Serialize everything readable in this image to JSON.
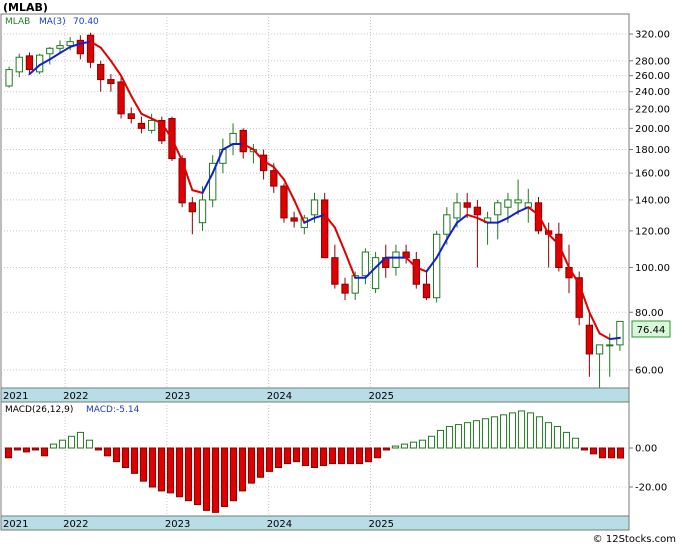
{
  "chart_data": [
    {
      "type": "candlestick",
      "title": "(MLAB)",
      "legend": {
        "symbol": "MLAB",
        "ma_label": "MA(3)",
        "ma_value": "70.40"
      },
      "last_price_label": "76.44",
      "y_scale": "log",
      "ylim": [
        52,
        340
      ],
      "y_ticks": [
        60,
        80,
        100,
        120,
        140,
        160,
        180,
        200,
        220,
        240,
        260,
        280,
        320
      ],
      "y_tick_labels": [
        "60.00",
        "80.00",
        "100.00",
        "120.00",
        "140.00",
        "160.00",
        "180.00",
        "200.00",
        "220.00",
        "240.00",
        "260.00",
        "280.00",
        "320.00"
      ],
      "x_labels": [
        "2021",
        "2022",
        "2023",
        "2024",
        "2025"
      ],
      "series": [
        {
          "name": "MLAB",
          "ohlc": [
            [
              247,
              272,
              245,
              268
            ],
            [
              265,
              290,
              258,
              285
            ],
            [
              287,
              292,
              262,
              268
            ],
            [
              265,
              290,
              262,
              288
            ],
            [
              290,
              300,
              275,
              298
            ],
            [
              298,
              310,
              290,
              302
            ],
            [
              302,
              315,
              295,
              308
            ],
            [
              310,
              318,
              282,
              290
            ],
            [
              318,
              322,
              270,
              278
            ],
            [
              275,
              280,
              240,
              255
            ],
            [
              255,
              262,
              240,
              250
            ],
            [
              252,
              258,
              210,
              215
            ],
            [
              215,
              222,
              205,
              210
            ],
            [
              205,
              212,
              195,
              200
            ],
            [
              198,
              215,
              195,
              208
            ],
            [
              208,
              212,
              185,
              188
            ],
            [
              210,
              212,
              170,
              172
            ],
            [
              172,
              175,
              135,
              138
            ],
            [
              138,
              142,
              118,
              132
            ],
            [
              125,
              150,
              120,
              140
            ],
            [
              140,
              175,
              135,
              168
            ],
            [
              168,
              190,
              160,
              180
            ],
            [
              185,
              205,
              175,
              195
            ],
            [
              198,
              200,
              172,
              178
            ],
            [
              178,
              185,
              168,
              180
            ],
            [
              175,
              180,
              155,
              162
            ],
            [
              162,
              168,
              145,
              150
            ],
            [
              150,
              152,
              125,
              128
            ],
            [
              128,
              132,
              122,
              126
            ],
            [
              122,
              130,
              118,
              128
            ],
            [
              130,
              145,
              125,
              140
            ],
            [
              140,
              145,
              105,
              105
            ],
            [
              105,
              112,
              90,
              92
            ],
            [
              92,
              95,
              85,
              88
            ],
            [
              88,
              98,
              85,
              96
            ],
            [
              96,
              110,
              92,
              108
            ],
            [
              90,
              108,
              88,
              105
            ],
            [
              105,
              112,
              95,
              100
            ],
            [
              100,
              112,
              96,
              108
            ],
            [
              108,
              112,
              102,
              105
            ],
            [
              104,
              108,
              90,
              92
            ],
            [
              92,
              98,
              85,
              86
            ],
            [
              86,
              120,
              84,
              118
            ],
            [
              118,
              135,
              112,
              130
            ],
            [
              128,
              145,
              122,
              138
            ],
            [
              138,
              145,
              128,
              135
            ],
            [
              135,
              140,
              100,
              130
            ],
            [
              125,
              132,
              112,
              128
            ],
            [
              130,
              140,
              115,
              138
            ],
            [
              135,
              145,
              125,
              140
            ],
            [
              138,
              155,
              130,
              140
            ],
            [
              135,
              148,
              125,
              138
            ],
            [
              138,
              142,
              118,
              120
            ],
            [
              120,
              125,
              100,
              118
            ],
            [
              118,
              125,
              98,
              100
            ],
            [
              100,
              112,
              88,
              95
            ],
            [
              95,
              98,
              75,
              78
            ],
            [
              75,
              80,
              58,
              65
            ],
            [
              65,
              68,
              52,
              68
            ],
            [
              68,
              72,
              58,
              68
            ],
            [
              68,
              76,
              66,
              76.44
            ]
          ]
        },
        {
          "name": "MA(3)",
          "values": [
            null,
            null,
            262,
            274,
            282,
            291,
            300,
            305,
            308,
            299,
            280,
            260,
            235,
            215,
            210,
            205,
            190,
            170,
            147,
            145,
            160,
            180,
            185,
            185,
            180,
            170,
            165,
            155,
            140,
            125,
            128,
            130,
            122,
            108,
            95,
            95,
            100,
            105,
            105,
            105,
            100,
            98,
            105,
            115,
            125,
            130,
            128,
            125,
            125,
            128,
            132,
            135,
            130,
            118,
            112,
            100,
            92,
            80,
            72,
            70,
            70.4
          ]
        }
      ]
    },
    {
      "type": "bar",
      "title": "MACD(26,12,9)",
      "legend": {
        "params": "MACD(26,12,9)",
        "value_label": "MACD:-5.14"
      },
      "ylim": [
        -30,
        12
      ],
      "y_ticks": [
        0,
        -20
      ],
      "y_tick_labels": [
        "0.00",
        "-20.00"
      ],
      "x_labels": [
        "2021",
        "2022",
        "2023",
        "2024",
        "2025"
      ],
      "values": [
        -5,
        -1,
        -2,
        -1,
        -4,
        2,
        4,
        6,
        8,
        4,
        -1,
        -4,
        -7,
        -10,
        -13,
        -17,
        -20,
        -22,
        -23,
        -25,
        -27,
        -29,
        -32,
        -33,
        -30,
        -27,
        -22,
        -18,
        -15,
        -12,
        -10,
        -8,
        -7,
        -9,
        -10,
        -9,
        -8,
        -8,
        -8,
        -8,
        -7,
        -5,
        -1,
        1,
        2,
        3,
        4,
        6,
        9,
        11,
        12,
        13,
        14,
        15,
        16,
        17,
        18,
        19,
        18,
        16,
        13,
        11,
        8,
        5,
        -1,
        -3,
        -5,
        -5,
        -5.14
      ]
    }
  ],
  "watermark": "© 12Stocks.com"
}
